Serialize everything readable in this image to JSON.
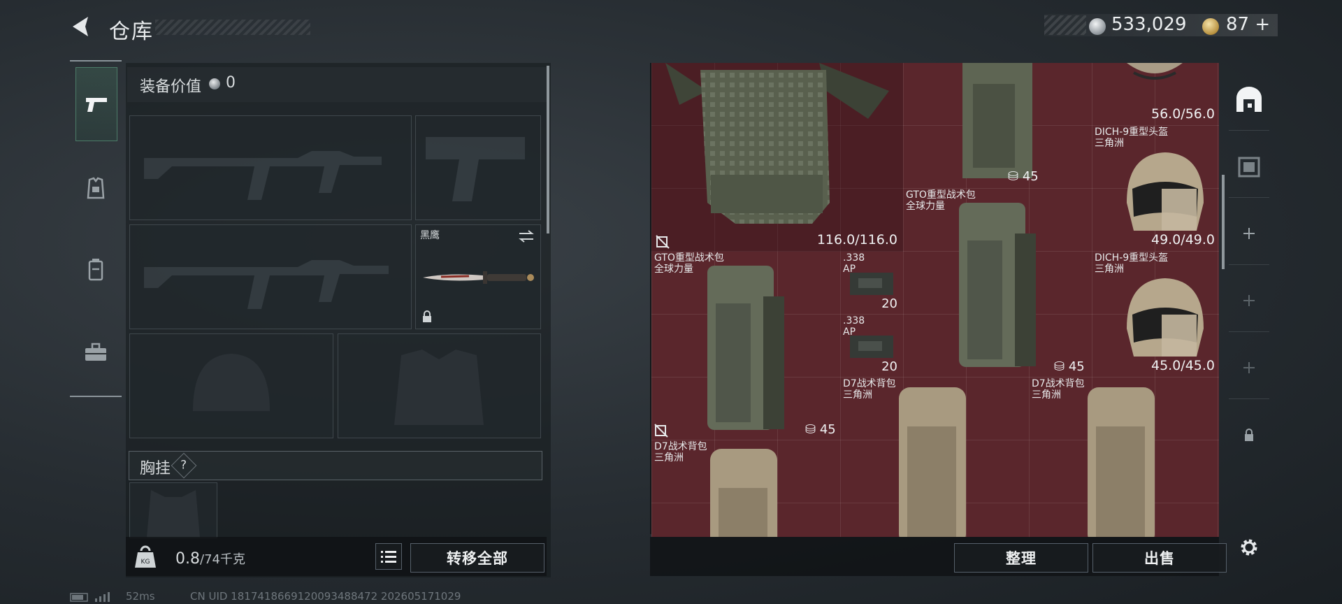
{
  "header": {
    "title": "仓库"
  },
  "currency": {
    "silver": "533,029",
    "gold": "87 +"
  },
  "equipment": {
    "title": "装备价值",
    "value": "0"
  },
  "melee": {
    "name": "黑鹰"
  },
  "chest_rig": {
    "label": "胸挂",
    "help": "?"
  },
  "weight": {
    "current": "0.8",
    "max": "/74千克"
  },
  "buttons": {
    "transfer_all": "转移全部",
    "organize": "整理",
    "sell": "出售"
  },
  "stash_items": [
    {
      "id": "vest",
      "durability": "116.0/116.0"
    },
    {
      "id": "pack-top",
      "count": "45"
    },
    {
      "id": "helmet-top",
      "durability": "56.0/56.0"
    },
    {
      "id": "helmet-1",
      "name": "DICH-9重型头盔",
      "sub": "三角洲",
      "durability": "49.0/49.0"
    },
    {
      "id": "gto-1",
      "name": "GTO重型战术包",
      "sub": "全球力量",
      "count": "45"
    },
    {
      "id": "gto-2",
      "name": "GTO重型战术包",
      "sub": "全球力量",
      "count": "45"
    },
    {
      "id": "ammo-1",
      "name": ".338",
      "sub": "AP",
      "count": "20"
    },
    {
      "id": "ammo-2",
      "name": ".338",
      "sub": "AP",
      "count": "20"
    },
    {
      "id": "helmet-2",
      "name": "DICH-9重型头盔",
      "sub": "三角洲",
      "durability": "45.0/45.0"
    },
    {
      "id": "d7-1",
      "name": "D7战术背包",
      "sub": "三角洲"
    },
    {
      "id": "d7-2",
      "name": "D7战术背包",
      "sub": "三角洲"
    },
    {
      "id": "d7-3",
      "name": "D7战术背包",
      "sub": "三角洲"
    }
  ],
  "status": {
    "ping": "52ms",
    "uid": "CN UID 1817418669120093488472 202605171029"
  },
  "colors": {
    "stash_bg": "#5a262c",
    "accent_green": "#4c7c68",
    "panel": "#131719"
  }
}
